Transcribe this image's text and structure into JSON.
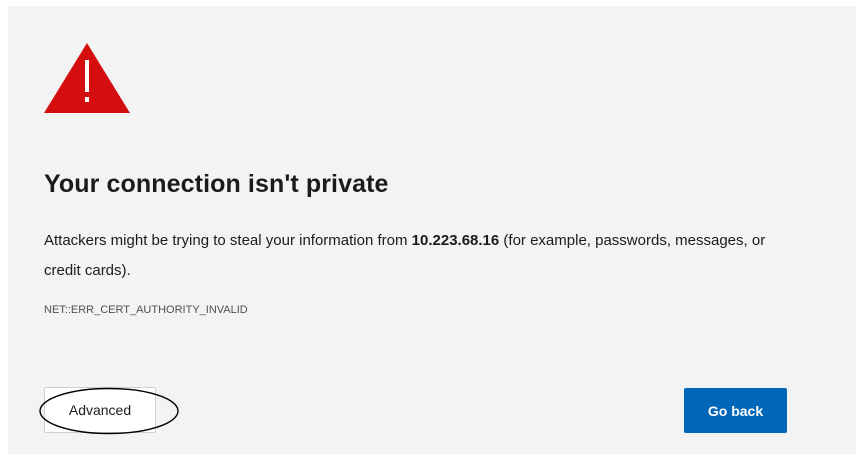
{
  "icon": {
    "name": "warning-icon",
    "color": "#d40e0e"
  },
  "title": "Your connection isn't private",
  "description": {
    "before": "Attackers might be trying to steal your information from ",
    "host": "10.223.68.16",
    "after": " (for example, passwords, messages, or credit cards)."
  },
  "error_code": "NET::ERR_CERT_AUTHORITY_INVALID",
  "buttons": {
    "advanced_label": "Advanced",
    "go_back_label": "Go back"
  },
  "colors": {
    "page_background": "#f3f3f3",
    "primary_button": "#0067b8",
    "annotation": "#000000"
  }
}
